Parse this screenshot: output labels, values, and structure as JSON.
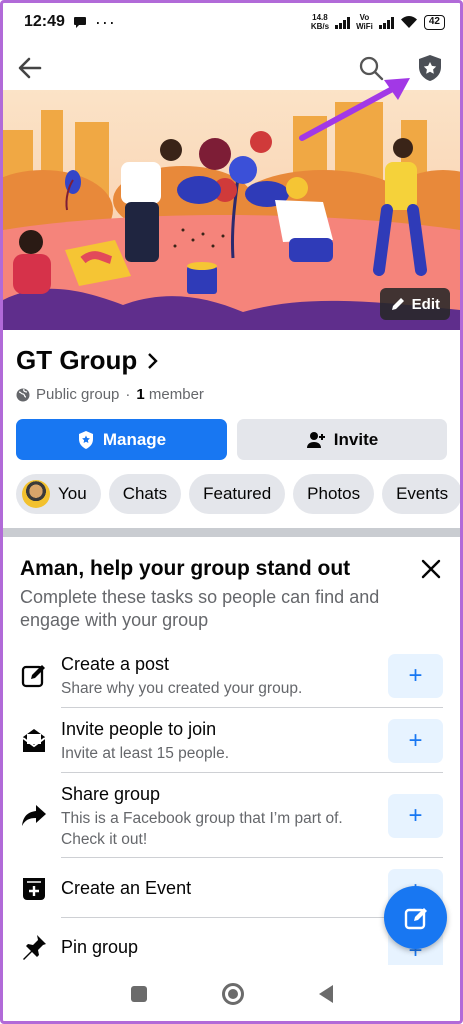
{
  "status_bar": {
    "time": "12:49",
    "net_speed_value": "14.8",
    "net_speed_unit": "KB/s",
    "volte": "Vo",
    "wifi_label": "WiFi",
    "battery": "42"
  },
  "group": {
    "name": "GT Group",
    "privacy": "Public group",
    "separator": "·",
    "member_count": "1",
    "member_label": "member",
    "edit_label": "Edit"
  },
  "actions": {
    "manage_label": "Manage",
    "invite_label": "Invite"
  },
  "tabs": [
    {
      "label": "You"
    },
    {
      "label": "Chats"
    },
    {
      "label": "Featured"
    },
    {
      "label": "Photos"
    },
    {
      "label": "Events"
    }
  ],
  "card": {
    "title": "Aman, help your group stand out",
    "description": "Complete these tasks so people can find and engage with your group",
    "tasks": [
      {
        "title": "Create a post",
        "subtitle": "Share why you created your group.",
        "icon": "compose-icon",
        "add": "+"
      },
      {
        "title": "Invite people to join",
        "subtitle": "Invite at least 15 people.",
        "icon": "envelope-icon",
        "add": "+"
      },
      {
        "title": "Share group",
        "subtitle": "This is a Facebook group that I’m part of. Check it out!",
        "icon": "share-arrow-icon",
        "add": "+"
      },
      {
        "title": "Create an Event",
        "subtitle": "",
        "icon": "calendar-plus-icon",
        "add": "+"
      },
      {
        "title": "Pin group",
        "subtitle": "",
        "icon": "pin-icon",
        "add": "+"
      }
    ]
  },
  "colors": {
    "accent": "#1877f2",
    "highlight_arrow": "#a238e6",
    "chip_bg": "#e4e6eb"
  }
}
